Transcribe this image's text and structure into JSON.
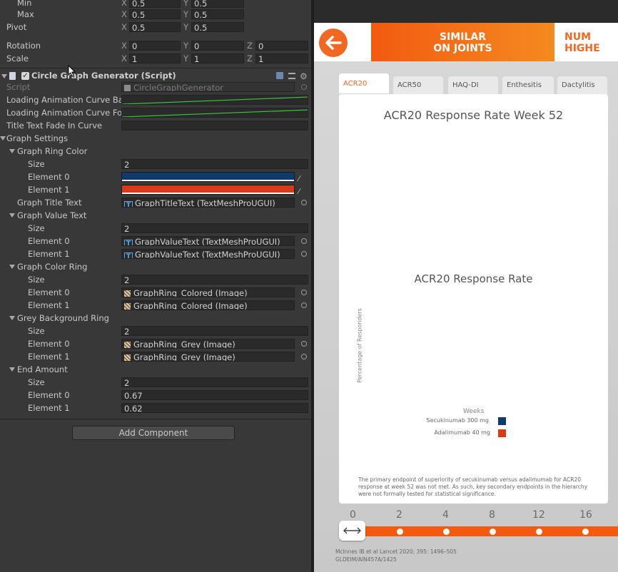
{
  "inspector": {
    "transform": {
      "min_label": "Min",
      "max_label": "Max",
      "pivot_label": "Pivot",
      "rotation_label": "Rotation",
      "scale_label": "Scale",
      "min": {
        "x": "0.5",
        "y": "0.5"
      },
      "max": {
        "x": "0.5",
        "y": "0.5"
      },
      "pivot": {
        "x": "0.5",
        "y": "0.5"
      },
      "rotation": {
        "x": "0",
        "y": "0",
        "z": "0"
      },
      "scale": {
        "x": "1",
        "y": "1",
        "z": "1"
      },
      "axis_x": "X",
      "axis_y": "Y",
      "axis_z": "Z"
    },
    "component": {
      "title": "Circle Graph Generator (Script)",
      "script_label": "Script",
      "script_value": "CircleGraphGenerator",
      "loading_curve_back_label": "Loading Animation Curve Ba",
      "loading_curve_fore_label": "Loading Animation Curve Fo",
      "title_fade_label": "Title Text Fade In Curve",
      "graph_settings_label": "Graph Settings",
      "ring_color": {
        "label": "Graph Ring Color",
        "size_label": "Size",
        "size": "2",
        "el0_label": "Element 0",
        "el1_label": "Element 1",
        "el0_color": "#0e3a6c",
        "el1_color": "#d83a1a"
      },
      "title_text": {
        "label": "Graph Title Text",
        "value": "GraphTitleText (TextMeshProUGUI)"
      },
      "value_text": {
        "label": "Graph Value Text",
        "size_label": "Size",
        "size": "2",
        "el0_label": "Element 0",
        "el0": "GraphValueText (TextMeshProUGUI)",
        "el1_label": "Element 1",
        "el1": "GraphValueText (TextMeshProUGUI)"
      },
      "color_ring": {
        "label": "Graph Color Ring",
        "size_label": "Size",
        "size": "2",
        "el0_label": "Element 0",
        "el0": "GraphRing_Colored (Image)",
        "el1_label": "Element 1",
        "el1": "GraphRing_Colored (Image)"
      },
      "grey_ring": {
        "label": "Grey Background Ring",
        "size_label": "Size",
        "size": "2",
        "el0_label": "Element 0",
        "el0": "GraphRing_Grey (Image)",
        "el1_label": "Element 1",
        "el1": "GraphRing_Grey (Image)"
      },
      "end_amount": {
        "label": "End Amount",
        "size_label": "Size",
        "size": "2",
        "el0_label": "Element 0",
        "el0": "0.67",
        "el1_label": "Element 1",
        "el1": "0.62"
      }
    },
    "add_component": "Add Component"
  },
  "game": {
    "banner_line1": "SIMILAR",
    "banner_line2": "ON JOINTS",
    "banner2_line1": "NUM",
    "banner2_line2": "HIGHE",
    "tabs": [
      "ACR20",
      "ACR50",
      "HAQ-DI",
      "Enthesitis",
      "Dactylitis"
    ],
    "card_title": "ACR20 Response Rate Week 52",
    "chart_title": "ACR20 Response Rate",
    "ylabel": "Percentage of Responders",
    "xlabel": "Weeks",
    "legend": [
      {
        "label": "Secukinumab 300 mg",
        "color": "#0e3a6c"
      },
      {
        "label": "Adalimumab 40 mg",
        "color": "#d83a1a"
      }
    ],
    "footnote": "The primary endpoint of superiority of secukinumab versus adalimumab for ACR20 response at week 52 was not met. As such, key secondary endpoints in the hierarchy were not formally tested for statistical significance.",
    "timeline": [
      "0",
      "2",
      "4",
      "8",
      "12",
      "16"
    ],
    "ref_line1": "McInnes IB et al Lancet 2020; 395: 1496–505",
    "ref_line2": "GLDEIM/AIN457A/1425",
    "accent": "#f26722"
  }
}
